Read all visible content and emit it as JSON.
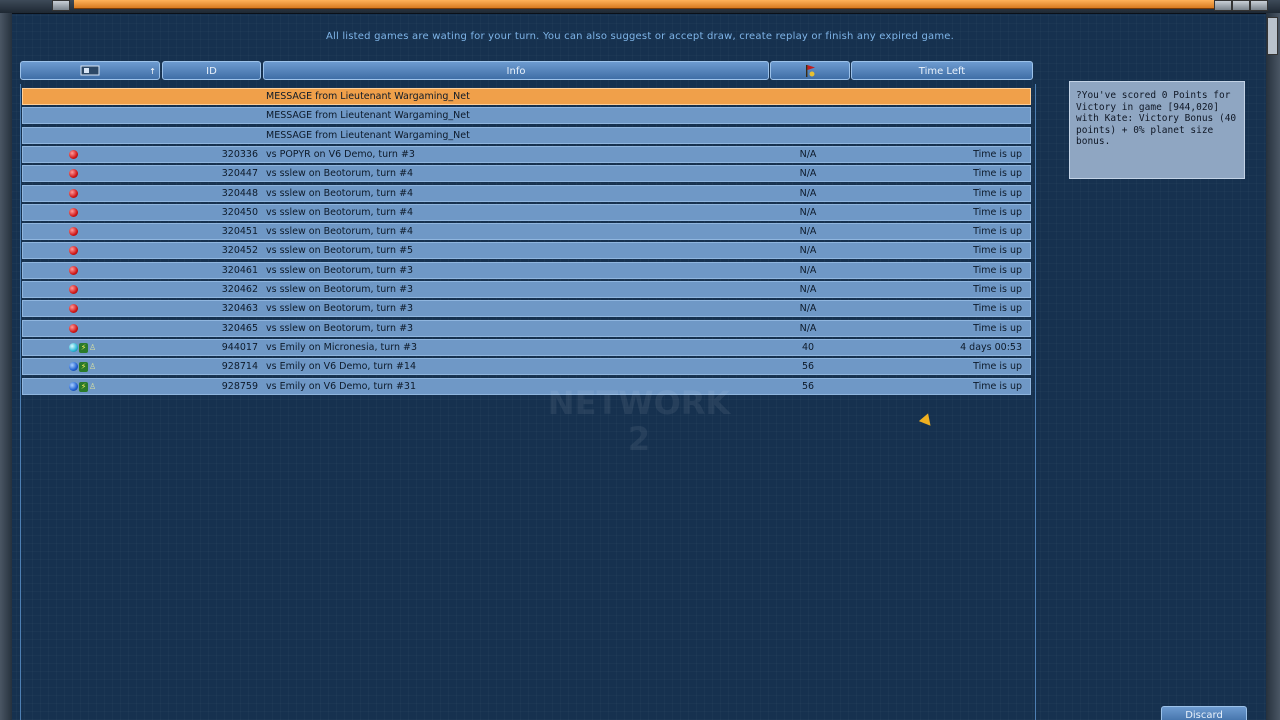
{
  "notice": "All listed games are wating for your turn. You can also suggest or accept draw, create replay or finish any expired game.",
  "table": {
    "headers": {
      "icon": "",
      "id": "ID",
      "info": "Info",
      "flag": "",
      "time_left": "Time Left"
    },
    "rows": [
      {
        "id": "",
        "info": "MESSAGE from Lieutenant Wargaming_Net",
        "points": "",
        "time": "",
        "icons": [],
        "selected": true
      },
      {
        "id": "",
        "info": "MESSAGE from Lieutenant Wargaming_Net",
        "points": "",
        "time": "",
        "icons": []
      },
      {
        "id": "",
        "info": "MESSAGE from Lieutenant Wargaming_Net",
        "points": "",
        "time": "",
        "icons": []
      },
      {
        "id": "320336",
        "info": "vs POPYR on V6 Demo, turn #3",
        "points": "N/A",
        "time": "Time is up",
        "icons": [
          "red"
        ]
      },
      {
        "id": "320447",
        "info": "vs sslew on Beotorum, turn #4",
        "points": "N/A",
        "time": "Time is up",
        "icons": [
          "red"
        ]
      },
      {
        "id": "320448",
        "info": "vs sslew on Beotorum, turn #4",
        "points": "N/A",
        "time": "Time is up",
        "icons": [
          "red"
        ]
      },
      {
        "id": "320450",
        "info": "vs sslew on Beotorum, turn #4",
        "points": "N/A",
        "time": "Time is up",
        "icons": [
          "red"
        ]
      },
      {
        "id": "320451",
        "info": "vs sslew on Beotorum, turn #4",
        "points": "N/A",
        "time": "Time is up",
        "icons": [
          "red"
        ]
      },
      {
        "id": "320452",
        "info": "vs sslew on Beotorum, turn #5",
        "points": "N/A",
        "time": "Time is up",
        "icons": [
          "red"
        ]
      },
      {
        "id": "320461",
        "info": "vs sslew on Beotorum, turn #3",
        "points": "N/A",
        "time": "Time is up",
        "icons": [
          "red"
        ]
      },
      {
        "id": "320462",
        "info": "vs sslew on Beotorum, turn #3",
        "points": "N/A",
        "time": "Time is up",
        "icons": [
          "red"
        ]
      },
      {
        "id": "320463",
        "info": "vs sslew on Beotorum, turn #3",
        "points": "N/A",
        "time": "Time is up",
        "icons": [
          "red"
        ]
      },
      {
        "id": "320465",
        "info": "vs sslew on Beotorum, turn #3",
        "points": "N/A",
        "time": "Time is up",
        "icons": [
          "red"
        ]
      },
      {
        "id": "944017",
        "info": "vs Emily on Micronesia, turn #3",
        "points": "40",
        "time": "4 days 00:53",
        "icons": [
          "cyan",
          "bolt",
          "man"
        ]
      },
      {
        "id": "928714",
        "info": "vs Emily on V6 Demo, turn #14",
        "points": "56",
        "time": "Time is up",
        "icons": [
          "blue",
          "bolt",
          "man"
        ]
      },
      {
        "id": "928759",
        "info": "vs Emily on V6 Demo, turn #31",
        "points": "56",
        "time": "Time is up",
        "icons": [
          "blue",
          "bolt",
          "man"
        ]
      }
    ]
  },
  "info_panel": {
    "text": "?You've scored 0 Points for Victory in game [944,020] with Kate: Victory Bonus (40 points) + 0% planet size bonus."
  },
  "buttons": {
    "discard": "Discard"
  },
  "icons": {
    "header_icon": "monitor-icon",
    "header_flag": "flag-icon"
  },
  "colors": {
    "selected_row": "#f0a04a",
    "row": "#6f98c6",
    "background": "#16314f"
  }
}
